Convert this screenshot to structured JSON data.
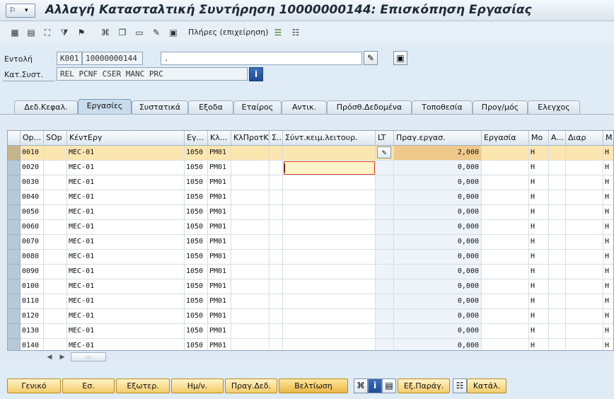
{
  "title": "Αλλαγή Κατασταλτική Συντήρηση 10000000144: Επισκόπηση Εργασίας",
  "toolbar": {
    "mode_label": "Πλήρες (επιχείρηση)",
    "icons": [
      "hierarchy-icon",
      "calculator-icon",
      "org-icon",
      "filter-icon",
      "flag-icon",
      "tree-icon",
      "copy-icon",
      "document-icon",
      "edit-icon",
      "clipboard-icon",
      "list-green-icon",
      "list-icon"
    ]
  },
  "header": {
    "order_label": "Εντολή",
    "order_type": "K001",
    "order_number": "10000000144",
    "order_text": ".",
    "status_label": "Κατ.Συστ.",
    "status_value": "REL  PCNF CSER MANC PRC"
  },
  "tabs": [
    {
      "label": "Δεδ.Κεφαλ."
    },
    {
      "label": "Εργασίες"
    },
    {
      "label": "Συστατικά"
    },
    {
      "label": "Εξοδα"
    },
    {
      "label": "Εταίρος"
    },
    {
      "label": "Αντικ."
    },
    {
      "label": "Πρόσθ.Δεδομένα"
    },
    {
      "label": "Τοποθεσία"
    },
    {
      "label": "Προγ/μός"
    },
    {
      "label": "Ελεγχος"
    }
  ],
  "active_tab": "Εργασίες",
  "table": {
    "columns": [
      "Op...",
      "SOp",
      "ΚέντΕργ",
      "Εγ...",
      "Κλ...",
      "ΚλΠροτΚ",
      "Σ...",
      "Σύντ.κειμ.λειτουρ.",
      "LT",
      "Πραγ.εργασ.",
      "Εργασία",
      "Μο",
      "Α...",
      "Διαρ",
      "Μ"
    ],
    "rows": [
      {
        "op": "0010",
        "center": "MEC-01",
        "plant": "1050",
        "key": "PM01",
        "actual": "2,000",
        "unit": "H",
        "unit2": "H"
      },
      {
        "op": "0020",
        "center": "MEC-01",
        "plant": "1050",
        "key": "PM01",
        "actual": "0,000",
        "unit": "H",
        "unit2": "H"
      },
      {
        "op": "0030",
        "center": "MEC-01",
        "plant": "1050",
        "key": "PM01",
        "actual": "0,000",
        "unit": "H",
        "unit2": "H"
      },
      {
        "op": "0040",
        "center": "MEC-01",
        "plant": "1050",
        "key": "PM01",
        "actual": "0,000",
        "unit": "H",
        "unit2": "H"
      },
      {
        "op": "0050",
        "center": "MEC-01",
        "plant": "1050",
        "key": "PM01",
        "actual": "0,000",
        "unit": "H",
        "unit2": "H"
      },
      {
        "op": "0060",
        "center": "MEC-01",
        "plant": "1050",
        "key": "PM01",
        "actual": "0,000",
        "unit": "H",
        "unit2": "H"
      },
      {
        "op": "0070",
        "center": "MEC-01",
        "plant": "1050",
        "key": "PM01",
        "actual": "0,000",
        "unit": "H",
        "unit2": "H"
      },
      {
        "op": "0080",
        "center": "MEC-01",
        "plant": "1050",
        "key": "PM01",
        "actual": "0,000",
        "unit": "H",
        "unit2": "H"
      },
      {
        "op": "0090",
        "center": "MEC-01",
        "plant": "1050",
        "key": "PM01",
        "actual": "0,000",
        "unit": "H",
        "unit2": "H"
      },
      {
        "op": "0100",
        "center": "MEC-01",
        "plant": "1050",
        "key": "PM01",
        "actual": "0,000",
        "unit": "H",
        "unit2": "H"
      },
      {
        "op": "0110",
        "center": "MEC-01",
        "plant": "1050",
        "key": "PM01",
        "actual": "0,000",
        "unit": "H",
        "unit2": "H"
      },
      {
        "op": "0120",
        "center": "MEC-01",
        "plant": "1050",
        "key": "PM01",
        "actual": "0,000",
        "unit": "H",
        "unit2": "H"
      },
      {
        "op": "0130",
        "center": "MEC-01",
        "plant": "1050",
        "key": "PM01",
        "actual": "0,000",
        "unit": "H",
        "unit2": "H"
      },
      {
        "op": "0140",
        "center": "MEC-01",
        "plant": "1050",
        "key": "PM01",
        "actual": "0,000",
        "unit": "H",
        "unit2": "H"
      }
    ]
  },
  "bottom_buttons": [
    "Γενικό",
    "Εσ.",
    "Εξωτερ.",
    "Ημ/ν.",
    "Πραγ.Δεδ.",
    "Βελτίωση",
    "Εξ.Παράγ.",
    "Κατάλ."
  ],
  "bottom_icons": [
    "hierarchy-icon",
    "info-icon",
    "print-icon",
    "list-icon"
  ]
}
